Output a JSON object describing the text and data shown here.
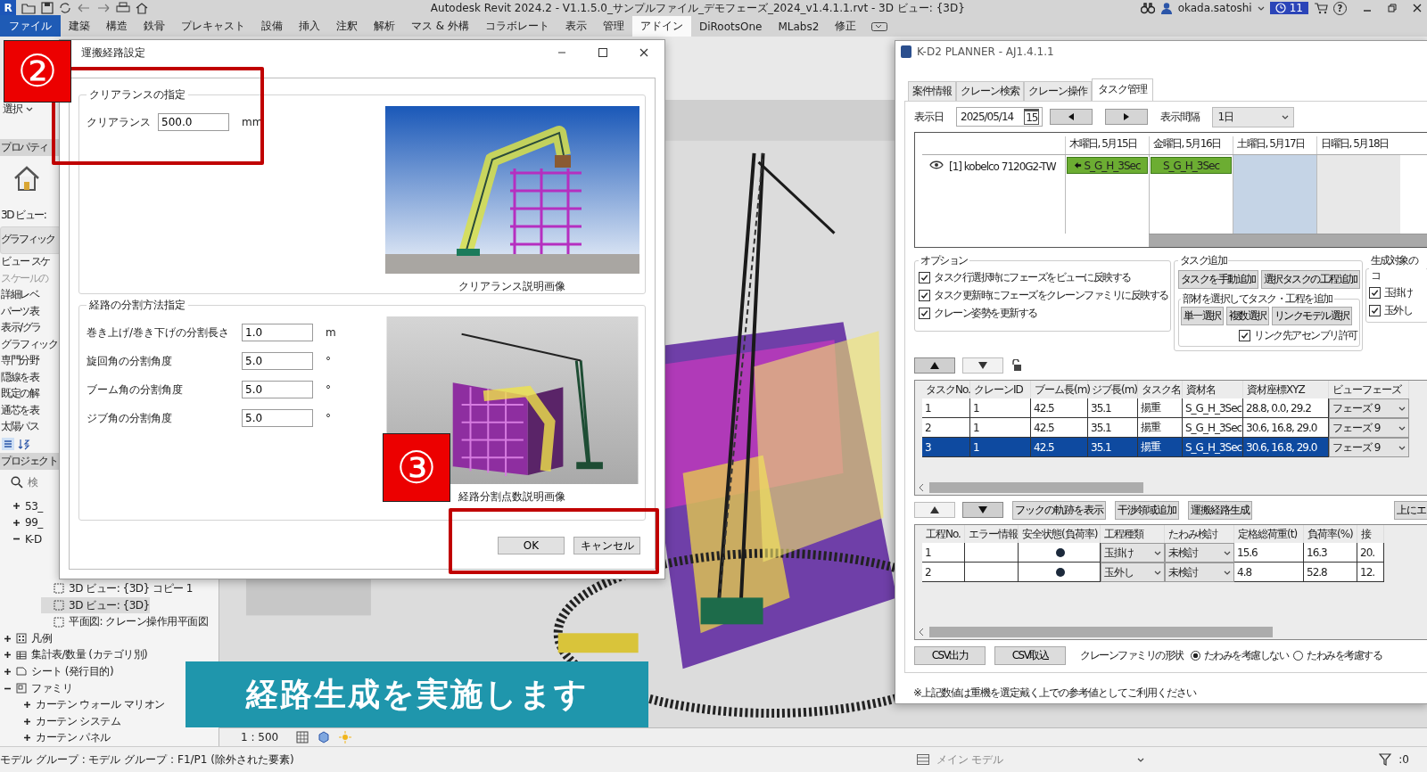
{
  "title_bar": {
    "app_logo": "R",
    "title": "Autodesk Revit 2024.2 - V1.1.5.0_サンプルファイル_デモフェーズ_2024_v1.4.1.1.rvt - 3D ビュー: {3D}",
    "user": "okada.satoshi",
    "notifications": "11",
    "help": "?"
  },
  "ribbon_tabs": [
    {
      "label": "ファイル",
      "kind": "file",
      "selected": false
    },
    {
      "label": "建築",
      "kind": "tab",
      "selected": false
    },
    {
      "label": "構造",
      "kind": "tab",
      "selected": false
    },
    {
      "label": "鉄骨",
      "kind": "tab",
      "selected": false
    },
    {
      "label": "プレキャスト",
      "kind": "tab",
      "selected": false
    },
    {
      "label": "設備",
      "kind": "tab",
      "selected": false
    },
    {
      "label": "挿入",
      "kind": "tab",
      "selected": false
    },
    {
      "label": "注釈",
      "kind": "tab",
      "selected": false
    },
    {
      "label": "解析",
      "kind": "tab",
      "selected": false
    },
    {
      "label": "マス & 外構",
      "kind": "tab",
      "selected": false
    },
    {
      "label": "コラボレート",
      "kind": "tab",
      "selected": false
    },
    {
      "label": "表示",
      "kind": "tab",
      "selected": false
    },
    {
      "label": "管理",
      "kind": "tab",
      "selected": false
    },
    {
      "label": "アドイン",
      "kind": "tab",
      "selected": true
    },
    {
      "label": "DiRootsOne",
      "kind": "tab",
      "selected": false
    },
    {
      "label": "MLabs2",
      "kind": "tab",
      "selected": false
    },
    {
      "label": "修正",
      "kind": "tab",
      "selected": false
    }
  ],
  "properties": {
    "selector": "選択",
    "title": "プロパティ",
    "type_label": "3D ビュー:",
    "rows": [
      {
        "label": "グラフィック",
        "kind": "group",
        "disabled": false
      },
      {
        "label": "ビュー スケ",
        "kind": "param",
        "disabled": false
      },
      {
        "label": "スケールの",
        "kind": "param",
        "disabled": true
      },
      {
        "label": "詳細レベ",
        "kind": "param",
        "disabled": false
      },
      {
        "label": "パーツ表",
        "kind": "param",
        "disabled": false
      },
      {
        "label": "表示/グラ",
        "kind": "param",
        "disabled": false
      },
      {
        "label": "グラフィック",
        "kind": "param",
        "disabled": false
      },
      {
        "label": "専門分野",
        "kind": "param",
        "disabled": false
      },
      {
        "label": "隠線を表",
        "kind": "param",
        "disabled": false
      },
      {
        "label": "既定の解",
        "kind": "param",
        "disabled": false
      },
      {
        "label": "通芯を表",
        "kind": "param",
        "disabled": false
      },
      {
        "label": "太陽パス",
        "kind": "param",
        "disabled": false
      }
    ]
  },
  "project_browser": {
    "title": "プロジェクト",
    "search_placeholder": "検",
    "views": [
      {
        "label": "53_",
        "expanded": false,
        "selected": false
      },
      {
        "label": "99_",
        "expanded": false,
        "selected": false
      },
      {
        "label": "K-D",
        "expanded": true,
        "selected": false,
        "children": [
          {
            "label": "3D ビュー: {3D} コピー 1",
            "kind": "view",
            "selected": false
          },
          {
            "label": "3D ビュー: {3D}",
            "kind": "view",
            "selected": true
          },
          {
            "label": "平面図: クレーン操作用平面図",
            "kind": "view",
            "selected": false
          }
        ]
      }
    ],
    "tree": [
      {
        "label": "凡例",
        "kind": "legend",
        "expanded": false,
        "selected": false
      },
      {
        "label": "集計表/数量 (カテゴリ別)",
        "kind": "schedule",
        "expanded": false,
        "selected": false
      },
      {
        "label": "シート (発行目的)",
        "kind": "sheet",
        "expanded": false,
        "selected": false
      },
      {
        "label": "ファミリ",
        "kind": "family",
        "expanded": true,
        "selected": false,
        "children": [
          {
            "label": "カーテン ウォール マリオン",
            "expanded": false,
            "selected": false
          },
          {
            "label": "カーテン システム",
            "expanded": false,
            "selected": false
          },
          {
            "label": "カーテン パネル",
            "expanded": false,
            "selected": false
          }
        ]
      }
    ]
  },
  "view": {
    "scale": "1 : 500"
  },
  "dialog": {
    "title": "運搬経路設定",
    "clearance": {
      "title": "クリアランスの指定",
      "label": "クリアランス",
      "value": "500.0",
      "unit": "mm",
      "caption": "クリアランス説明画像"
    },
    "division": {
      "title": "経路の分割方法指定",
      "caption": "経路分割点数説明画像",
      "rows": [
        {
          "label": "巻き上げ/巻き下げの分割長さ",
          "value": "1.0",
          "unit": "m"
        },
        {
          "label": "旋回角の分割角度",
          "value": "5.0",
          "unit": "°"
        },
        {
          "label": "ブーム角の分割角度",
          "value": "5.0",
          "unit": "°"
        },
        {
          "label": "ジブ角の分割角度",
          "value": "5.0",
          "unit": "°"
        }
      ]
    },
    "buttons": [
      "OK",
      "キャンセル"
    ]
  },
  "planner": {
    "title": "K-D2 PLANNER - AJ1.4.1.1",
    "tabs": [
      {
        "label": "案件情報",
        "selected": false
      },
      {
        "label": "クレーン検索",
        "selected": false
      },
      {
        "label": "クレーン操作",
        "selected": false
      },
      {
        "label": "タスク管理",
        "selected": true
      }
    ],
    "date_label": "表示日",
    "date": "2025/05/14",
    "calendar_day": "15",
    "interval_label": "表示間隔",
    "interval": "1日",
    "gantt": {
      "days": [
        {
          "label": "木曜日, 5月15日",
          "kind": "weekday"
        },
        {
          "label": "金曜日, 5月16日",
          "kind": "weekday"
        },
        {
          "label": "土曜日, 5月17日",
          "kind": "saturday"
        },
        {
          "label": "日曜日, 5月18日",
          "kind": "sunday"
        }
      ],
      "rows": [
        {
          "crane": "[1] kobelco 7120G2-TW",
          "tasks": [
            {
              "label": "S_G_H_3Sec",
              "continued": true
            },
            {
              "label": "S_G_H_3Sec",
              "continued": false
            }
          ]
        }
      ]
    },
    "options": {
      "title": "オプション",
      "items": [
        {
          "label": "タスク行選択時にフェーズをビューに反映する",
          "checked": true
        },
        {
          "label": "タスク更新時にフェーズをクレーンファミリに反映する",
          "checked": true
        },
        {
          "label": "クレーン姿勢を更新する",
          "checked": true
        }
      ]
    },
    "task_add": {
      "title": "タスク追加",
      "buttons": [
        "タスクを手動追加",
        "選択タスクの工程追加"
      ],
      "member_title": "部材を選択してタスク・工程を追加",
      "member_buttons": [
        "単一選択",
        "複数選択",
        "リンクモデル選択"
      ],
      "link_option": {
        "label": "リンク先アセンブリ許可",
        "checked": true
      }
    },
    "targets": {
      "title": "生成対象のコ",
      "items": [
        {
          "label": "玉掛け",
          "checked": true
        },
        {
          "label": "玉外し",
          "checked": true
        }
      ]
    },
    "task_table": {
      "columns": [
        "タスクNo.",
        "クレーンID",
        "ブーム長(m)",
        "ジブ長(m)",
        "タスク名",
        "資材名",
        "資材座標XYZ",
        "ビューフェーズ"
      ],
      "rows": [
        {
          "cells": [
            "1",
            "1",
            "42.5",
            "35.1",
            "揚重",
            "S_G_H_3Sec",
            "28.8, 0.0, 29.2"
          ],
          "phase": "フェーズ 9",
          "selected": false
        },
        {
          "cells": [
            "2",
            "1",
            "42.5",
            "35.1",
            "揚重",
            "S_G_H_3Sec",
            "30.6, 16.8, 29.0"
          ],
          "phase": "フェーズ 9",
          "selected": false
        },
        {
          "cells": [
            "3",
            "1",
            "42.5",
            "35.1",
            "揚重",
            "S_G_H_3Sec",
            "30.6, 16.8, 29.0"
          ],
          "phase": "フェーズ 9",
          "selected": true
        }
      ]
    },
    "actions": [
      "フックの軌跡を表示",
      "干渉領域追加",
      "運搬経路生成"
    ],
    "side_action": "上にエ",
    "process_table": {
      "columns": [
        "工程No.",
        "エラー情報",
        "安全状態(負荷率)",
        "工程種類",
        "たわみ検討",
        "定格総荷重(t)",
        "負荷率(%)",
        "接"
      ],
      "rows": [
        {
          "no": "1",
          "color": "#1c2a3c",
          "process_type": "玉掛け",
          "deflection": "未検討",
          "rated_load": "15.6",
          "load_rate": "16.3",
          "column_8": "20."
        },
        {
          "no": "2",
          "color": "#1c2a3c",
          "process_type": "玉外し",
          "deflection": "未検討",
          "rated_load": "4.8",
          "load_rate": "52.8",
          "column_8": "12."
        }
      ]
    },
    "csv_buttons": [
      "CSV出力",
      "CSV取込"
    ],
    "shape_label": "クレーンファミリの形状",
    "shape_options": [
      {
        "label": "たわみを考慮しない",
        "selected": true
      },
      {
        "label": "たわみを考慮する",
        "selected": false
      }
    ],
    "note": "※上記数値は重機を選定戴く上での参考値としてご利用ください"
  },
  "annotations": {
    "step_badges": [
      "②",
      "③"
    ],
    "caption": "経路生成を実施します"
  },
  "status_bar": {
    "selection": "モデル グループ : モデル グループ : F1/P1 (除外された要素)",
    "workset": "メイン モデル",
    "filter_count": ":0"
  }
}
